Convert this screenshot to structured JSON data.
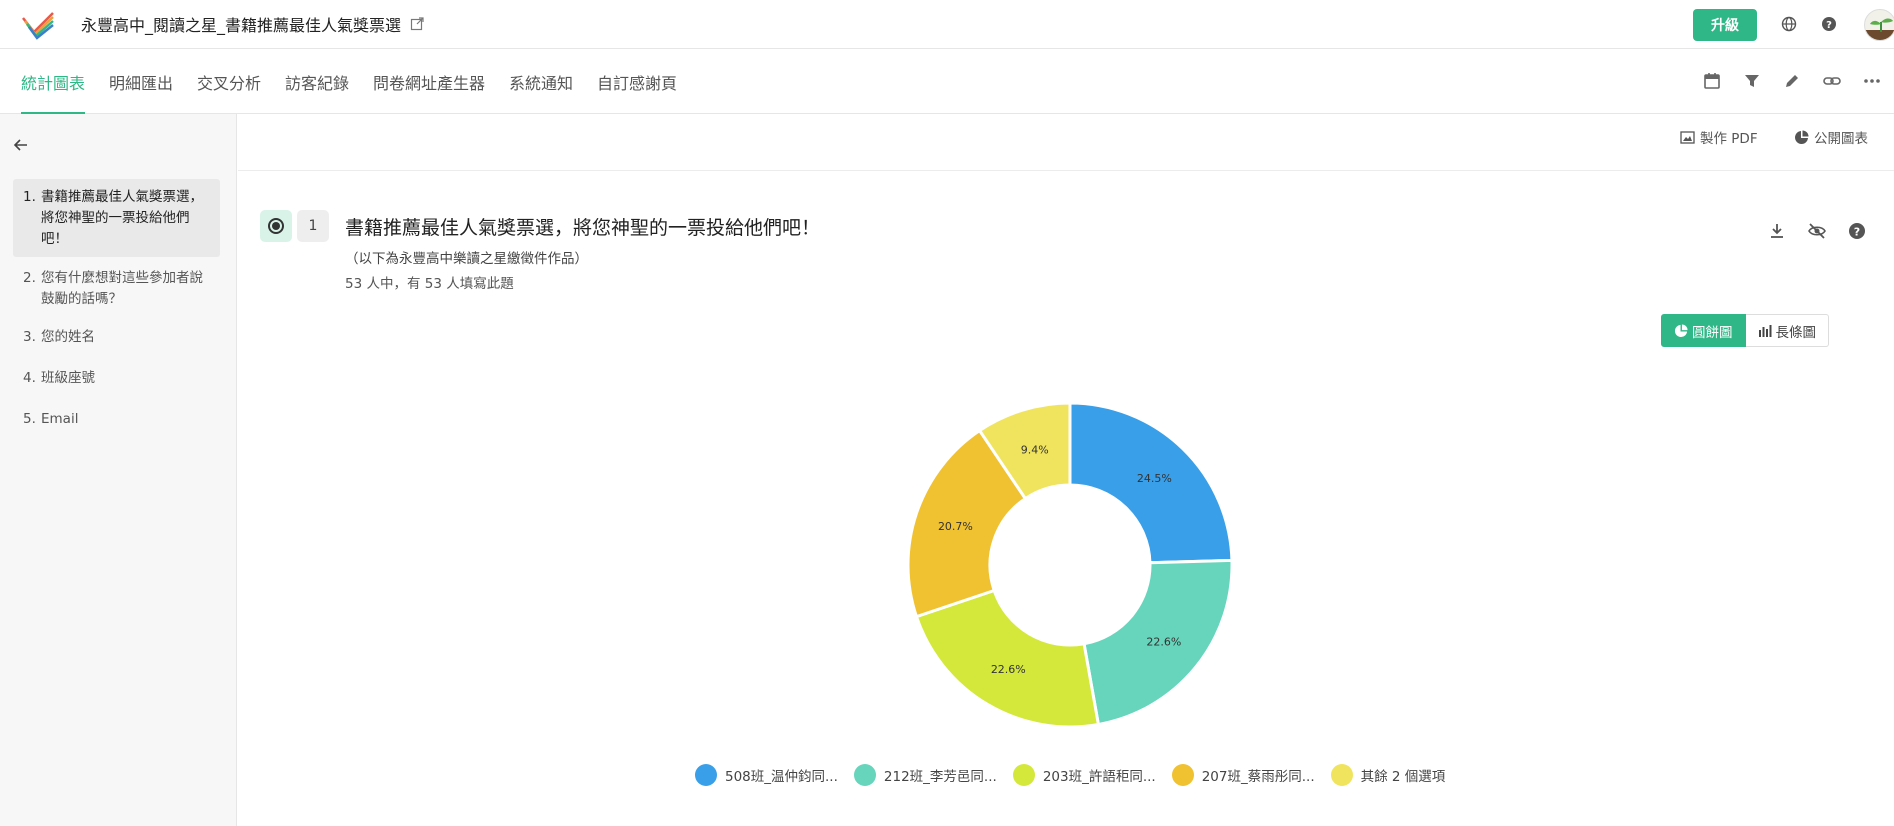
{
  "app": {
    "title": "永豐高中_閱讀之星_書籍推薦最佳人氣獎票選",
    "upgrade_label": "升級",
    "brand_color": "#2fb787"
  },
  "tabs": [
    {
      "label": "統計圖表",
      "active": true
    },
    {
      "label": "明細匯出",
      "active": false
    },
    {
      "label": "交叉分析",
      "active": false
    },
    {
      "label": "訪客紀錄",
      "active": false
    },
    {
      "label": "問卷網址產生器",
      "active": false
    },
    {
      "label": "系統通知",
      "active": false
    },
    {
      "label": "自訂感謝頁",
      "active": false
    }
  ],
  "toolbar_icons": [
    "calendar-icon",
    "filter-icon",
    "pencil-icon",
    "link-icon",
    "more-icon"
  ],
  "sidebar": {
    "questions": [
      {
        "num": "1.",
        "text": "書籍推薦最佳人氣獎票選，將您神聖的一票投給他們吧！",
        "active": true
      },
      {
        "num": "2.",
        "text": "您有什麼想對這些參加者說鼓勵的話嗎？",
        "active": false
      },
      {
        "num": "3.",
        "text": "您的姓名",
        "active": false
      },
      {
        "num": "4.",
        "text": "班級座號",
        "active": false
      },
      {
        "num": "5.",
        "text": "Email",
        "active": false
      }
    ]
  },
  "subbar": {
    "pdf_label": "製作 PDF",
    "public_chart_label": "公開圖表"
  },
  "question": {
    "index": "1",
    "title": "書籍推薦最佳人氣獎票選，將您神聖的一票投給他們吧！",
    "description": "（以下為永豐高中樂讀之星繳徵件作品）",
    "response_count": "53 人中，有 53 人填寫此題"
  },
  "chart_toggle": {
    "pie_label": "圓餅圖",
    "bar_label": "長條圖",
    "selected": "pie"
  },
  "chart_data": {
    "type": "pie",
    "donut": true,
    "categories": [
      "508班_温仲鈞同...",
      "212班_李芳邑同...",
      "203班_許語秬同...",
      "207班_蔡雨彤同...",
      "其餘 2 個選項"
    ],
    "values": [
      24.5,
      22.6,
      22.6,
      20.7,
      9.4
    ],
    "labels": [
      "24.5%",
      "22.6%",
      "22.6%",
      "20.7%",
      "9.4%"
    ],
    "colors": [
      "#3a9fe9",
      "#66d5bb",
      "#d4e83b",
      "#f0c232",
      "#f0e45e"
    ],
    "legend_position": "bottom"
  }
}
